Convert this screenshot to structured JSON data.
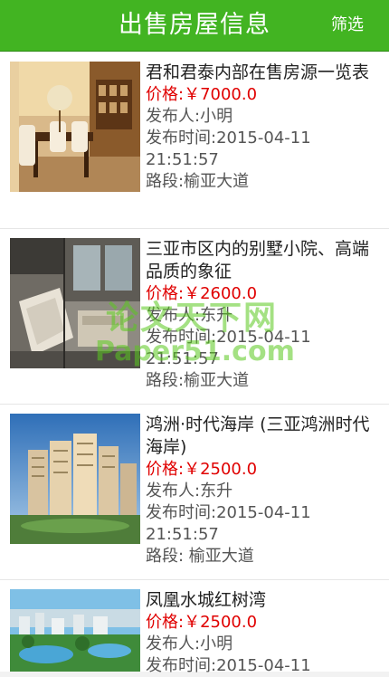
{
  "header": {
    "title": "出售房屋信息",
    "filter_label": "筛选"
  },
  "listings": [
    {
      "title": "君和君泰内部在售房源一览表",
      "price": "价格:￥7000.0",
      "publisher": "发布人:小明",
      "publish_time": "发布时间:2015-04-11 21:51:57",
      "road": "路段:榆亚大道"
    },
    {
      "title": "三亚市区内的别墅小院、高端品质的象征",
      "price": "价格:￥2600.0",
      "publisher": "发布人:东升",
      "publish_time": "发布时间:2015-04-11 21:51:57",
      "road": "路段:榆亚大道"
    },
    {
      "title": "鸿洲·时代海岸 (三亚鸿洲时代海岸)",
      "price": "价格:￥2500.0",
      "publisher": "发布人:东升",
      "publish_time": "发布时间:2015-04-11 21:51:57",
      "road": "路段: 榆亚大道"
    },
    {
      "title": "凤凰水城红树湾",
      "price": "价格:￥2500.0",
      "publisher": "发布人:小明",
      "publish_time": "发布时间:2015-04-11",
      "road": ""
    }
  ],
  "watermark": {
    "text_cn": "论文天下网",
    "text_en": "Paper51.com"
  },
  "colors": {
    "header_bg": "#42b422",
    "price": "#e00000"
  }
}
